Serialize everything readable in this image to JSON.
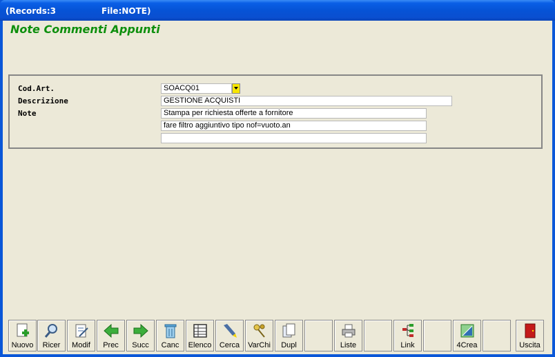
{
  "window": {
    "records": "(Records:3",
    "file": "File:NOTE)"
  },
  "form": {
    "title": "Note Commenti Appunti"
  },
  "fields": {
    "cod_label": "Cod.Art.",
    "cod_value": "SOACQ01",
    "desc_label": "Descrizione",
    "desc_value": "GESTIONE ACQUISTI",
    "note_label": "Note",
    "note1": "Stampa per richiesta offerte a fornitore",
    "note2": "fare filtro aggiuntivo tipo nof=vuoto.an",
    "note3": ""
  },
  "toolbar": {
    "nuovo": "Nuovo",
    "ricer": "Ricer",
    "modif": "Modif",
    "prec": "Prec",
    "succ": "Succ",
    "canc": "Canc",
    "elenco": "Elenco",
    "cerca": "Cerca",
    "varchi": "VarChi",
    "dupl": "Dupl",
    "liste": "Liste",
    "link": "Link",
    "crea": "4Crea",
    "uscita": "Uscita"
  },
  "icons": {
    "nuovo": "new-page-icon",
    "ricer": "magnifier-icon",
    "modif": "edit-page-icon",
    "prec": "arrow-left-icon",
    "succ": "arrow-right-icon",
    "canc": "trash-icon",
    "elenco": "list-icon",
    "cerca": "flashlight-icon",
    "varchi": "keys-icon",
    "dupl": "duplicate-icon",
    "liste": "printer-icon",
    "link": "tree-icon",
    "crea": "design-icon",
    "uscita": "exit-door-icon"
  },
  "colors": {
    "title_bar": "#0a5fe6",
    "form_title": "#0d8f0d",
    "dropdown": "#f7e600",
    "background": "#ece9d8"
  }
}
